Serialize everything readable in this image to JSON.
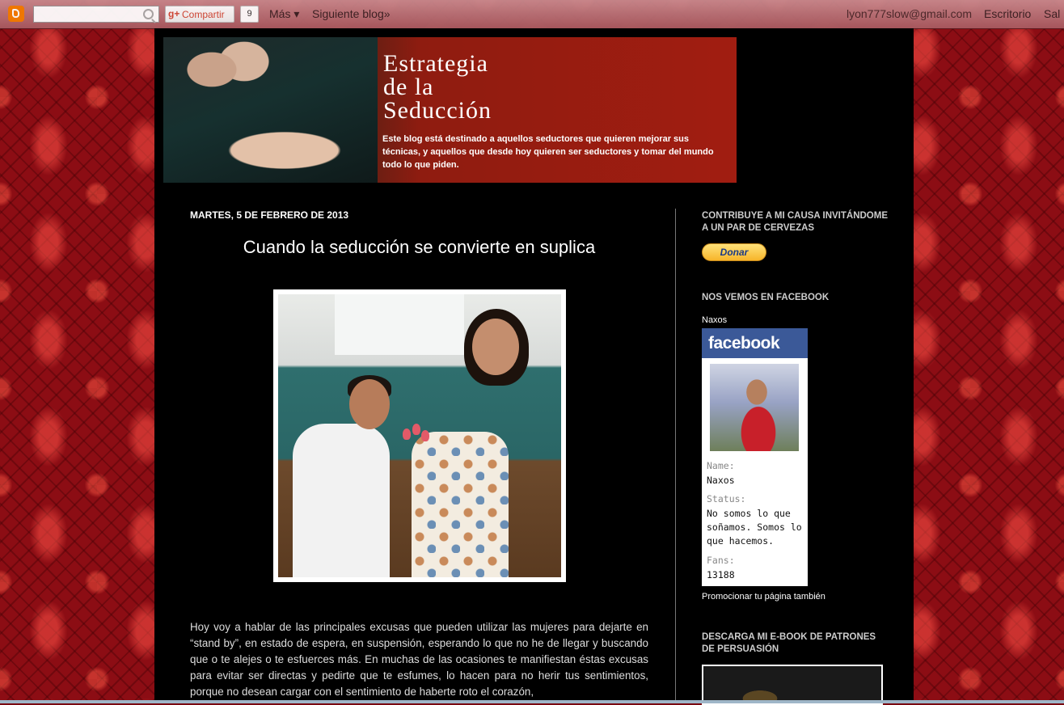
{
  "navbar": {
    "share_label": "Compartir",
    "share_count": "9",
    "more_label": "Más ▾",
    "next_blog_label": "Siguiente blog»",
    "email": "lyon777slow@gmail.com",
    "desktop_label": "Escritorio",
    "exit_label": "Sal"
  },
  "header": {
    "title": "Estrategia\nde la\nSeducción",
    "description": "Este blog está destinado a aquellos seductores que quieren mejorar sus técnicas, y aquellos que desde hoy quieren ser seductores y tomar del mundo todo lo que piden."
  },
  "post": {
    "date": "MARTES, 5 DE FEBRERO DE 2013",
    "title": "Cuando la seducción se convierte en suplica",
    "body": "Hoy voy  a hablar de las principales excusas que pueden utilizar las mujeres para dejarte en “stand by”, en estado de espera, en suspensión, esperando lo que no he de llegar y buscando que o te alejes o te esfuerces más. En muchas de las ocasiones te manifiestan éstas excusas para evitar ser directas y pedirte que te esfumes, lo hacen para no herir tus sentimientos, porque no desean cargar con el sentimiento de haberte roto el corazón,"
  },
  "sidebar": {
    "donate_title": "CONTRIBUYE A MI CAUSA INVITÁNDOME A UN PAR DE CERVEZAS",
    "donate_button": "Donar",
    "facebook_title": "NOS VEMOS EN FACEBOOK",
    "facebook_page_name": "Naxos",
    "facebook_badge": {
      "brand": "facebook",
      "name_label": "Name:",
      "name": "Naxos",
      "status_label": "Status:",
      "status": "No somos lo que\nsoñamos. Somos lo\nque hacemos.",
      "fans_label": "Fans:",
      "fans": "13188"
    },
    "promote_link": "Promocionar tu página también",
    "ebook_title": "DESCARGA MI E-BOOK DE PATRONES DE PERSUASIÓN"
  },
  "colors": {
    "background_red": "#8c0d14",
    "content_bg": "#000000",
    "facebook_blue": "#3b5998",
    "donate_yellow": "#f7b52a",
    "blogger_orange": "#f57d00"
  }
}
